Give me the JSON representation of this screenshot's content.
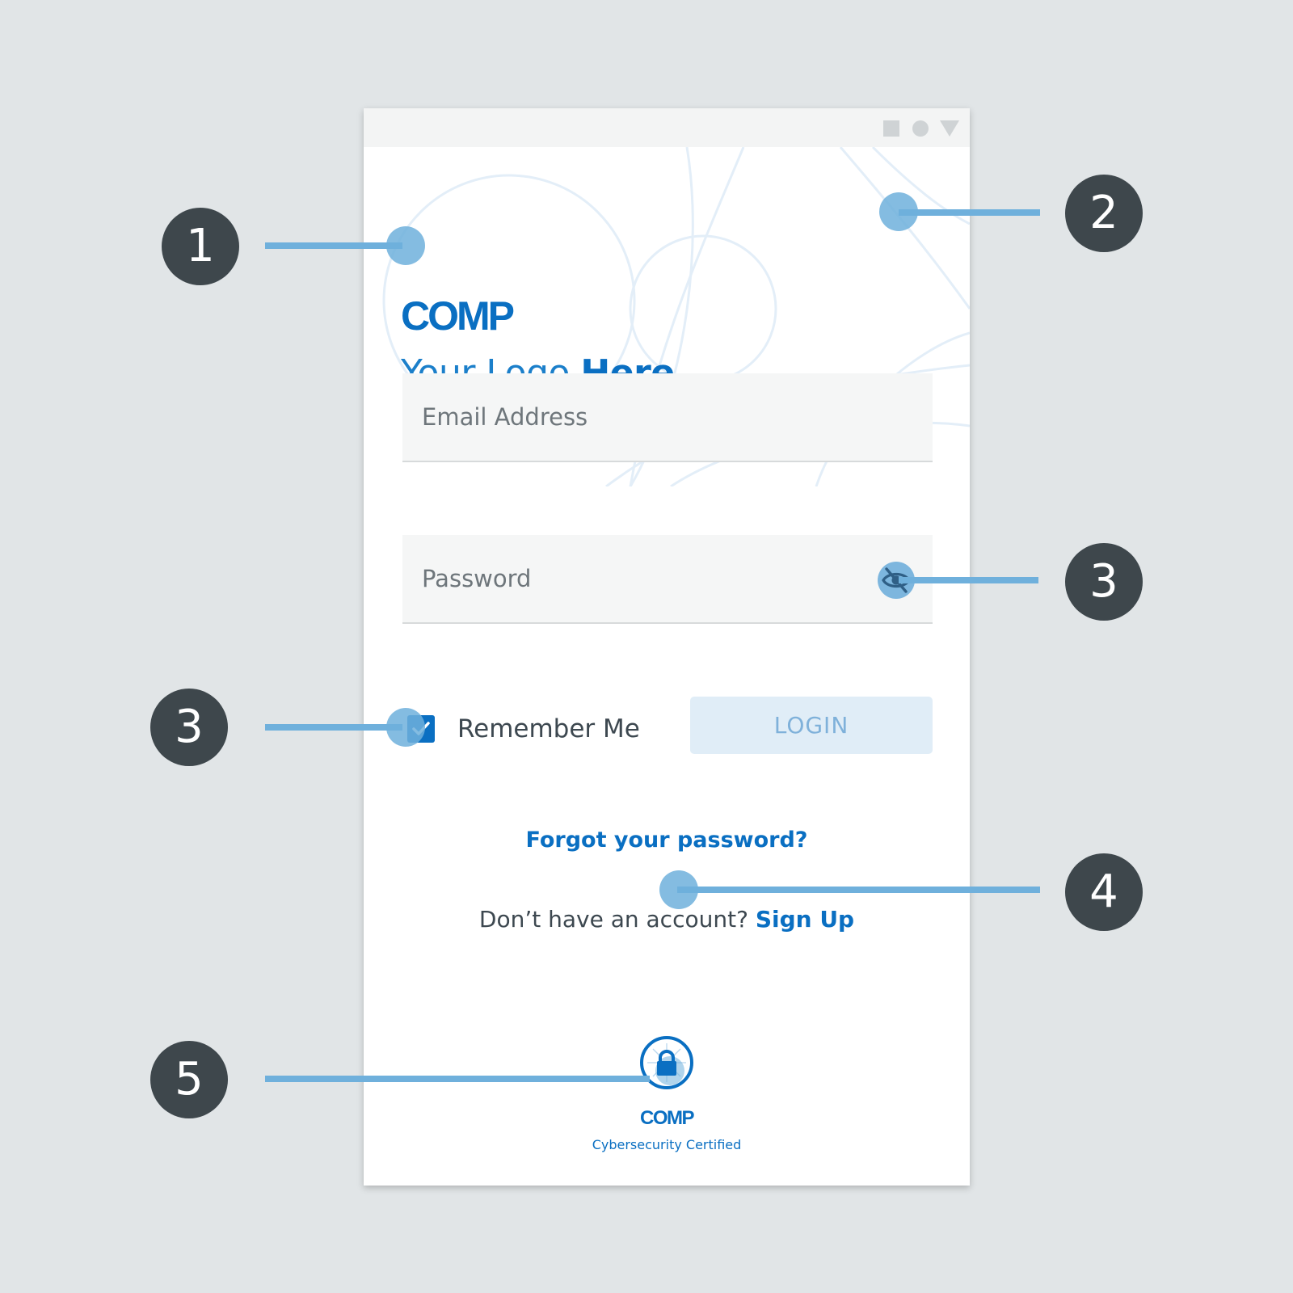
{
  "window": {
    "controls": [
      "square-icon",
      "circle-icon",
      "triangle-down-icon"
    ]
  },
  "logo": {
    "mark": "COMP",
    "tagline_light": "Your Logo ",
    "tagline_bold": "Here"
  },
  "form": {
    "email_placeholder": "Email Address",
    "password_placeholder": "Password",
    "password_toggle_icon": "eye-slash-icon",
    "remember_label": "Remember Me",
    "remember_checked": true,
    "login_label": "LOGIN"
  },
  "links": {
    "forgot_password": "Forgot your password?",
    "no_account_prompt": "Don’t have an account? ",
    "sign_up": "Sign Up"
  },
  "certification": {
    "icon": "lock-icon",
    "brand": "COMP",
    "caption": "Cybersecurity Certified"
  },
  "annotations": [
    "1",
    "2",
    "3",
    "3",
    "4",
    "5"
  ],
  "colors": {
    "background": "#e1e5e7",
    "brand_blue": "#0a6fc2",
    "callout_blue": "#6fb0dc",
    "marker_dark": "#3e474c",
    "login_button_bg": "#e0edf7",
    "field_bg": "#f5f6f6"
  }
}
